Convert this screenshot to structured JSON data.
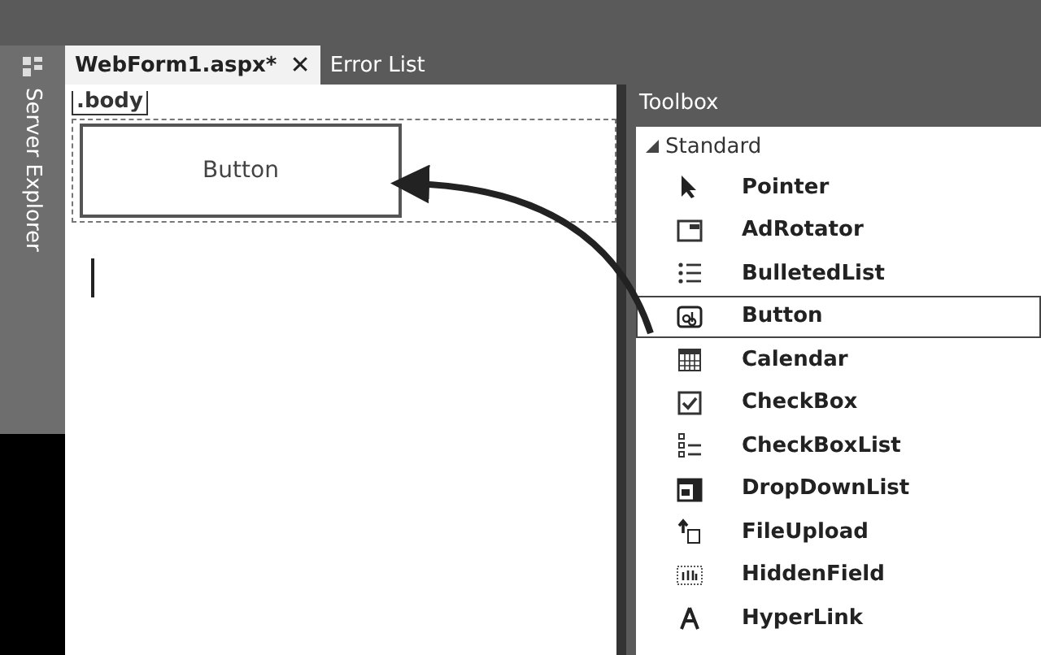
{
  "side_panel": {
    "label": "Server Explorer"
  },
  "tabs": [
    {
      "label": "WebForm1.aspx*",
      "selected": true,
      "close": "✕"
    },
    {
      "label": "Error List",
      "selected": false
    }
  ],
  "designer": {
    "tag": ".body",
    "button_label": "Button"
  },
  "toolbox": {
    "title": "Toolbox",
    "group": {
      "label": "Standard",
      "expanded": true,
      "items": [
        {
          "kind": "pointer",
          "label": "Pointer",
          "selected": false
        },
        {
          "kind": "adrotator",
          "label": "AdRotator",
          "selected": false
        },
        {
          "kind": "bulletedlist",
          "label": "BulletedList",
          "selected": false
        },
        {
          "kind": "button",
          "label": "Button",
          "selected": true
        },
        {
          "kind": "calendar",
          "label": "Calendar",
          "selected": false
        },
        {
          "kind": "checkbox",
          "label": "CheckBox",
          "selected": false
        },
        {
          "kind": "checkboxlist",
          "label": "CheckBoxList",
          "selected": false
        },
        {
          "kind": "dropdownlist",
          "label": "DropDownList",
          "selected": false
        },
        {
          "kind": "fileupload",
          "label": "FileUpload",
          "selected": false
        },
        {
          "kind": "hiddenfield",
          "label": "HiddenField",
          "selected": false
        },
        {
          "kind": "hyperlink",
          "label": "HyperLink",
          "selected": false
        }
      ]
    }
  }
}
